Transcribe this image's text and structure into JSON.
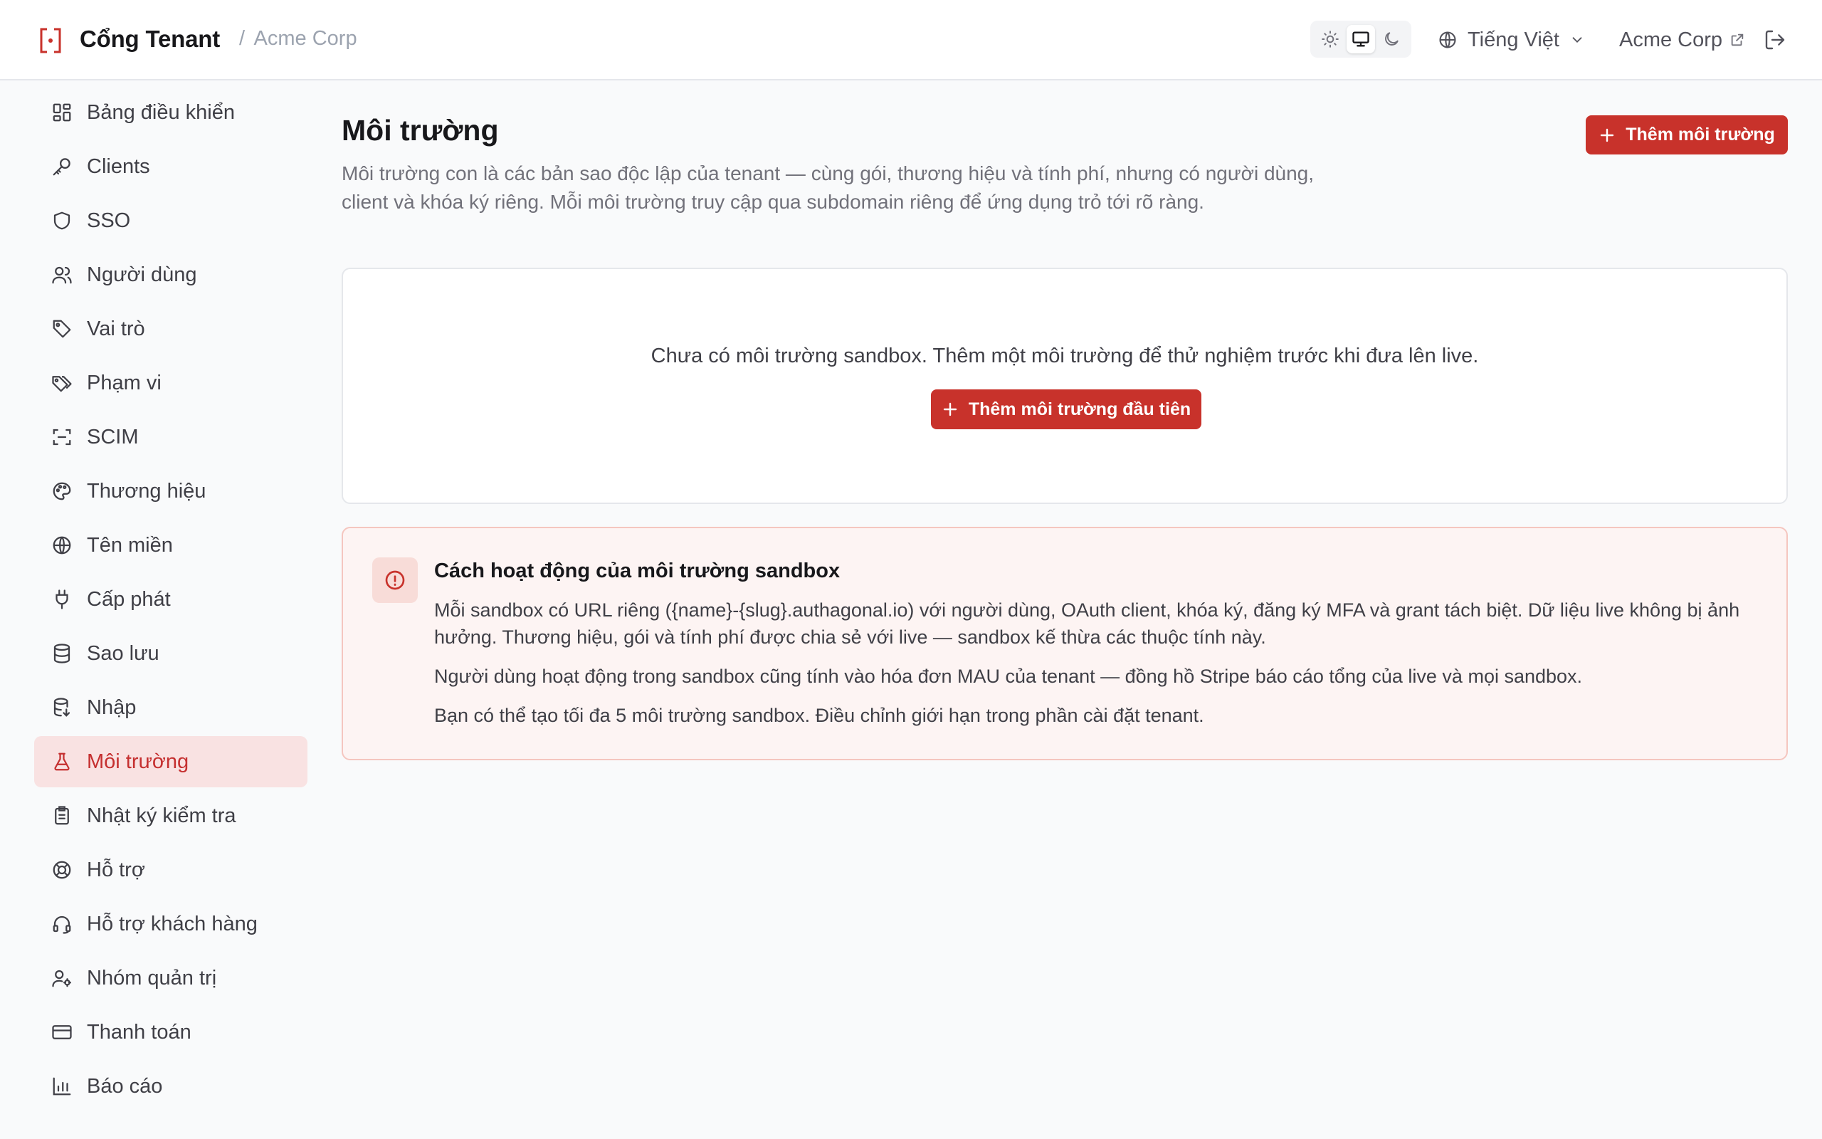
{
  "header": {
    "app_title": "Cổng Tenant",
    "breadcrumb_sep": "/",
    "breadcrumb_tenant": "Acme Corp",
    "theme_options": [
      "light",
      "system",
      "dark"
    ],
    "theme_selected": "system",
    "language": "Tiếng Việt",
    "tenant_link": "Acme Corp"
  },
  "sidebar": {
    "items": [
      {
        "label": "Bảng điều khiển",
        "icon": "dashboard-icon"
      },
      {
        "label": "Clients",
        "icon": "key-icon"
      },
      {
        "label": "SSO",
        "icon": "shield-icon"
      },
      {
        "label": "Người dùng",
        "icon": "users-icon"
      },
      {
        "label": "Vai trò",
        "icon": "tag-icon"
      },
      {
        "label": "Phạm vi",
        "icon": "tags-icon"
      },
      {
        "label": "SCIM",
        "icon": "scan-icon"
      },
      {
        "label": "Thương hiệu",
        "icon": "palette-icon"
      },
      {
        "label": "Tên miền",
        "icon": "globe-icon"
      },
      {
        "label": "Cấp phát",
        "icon": "plug-icon"
      },
      {
        "label": "Sao lưu",
        "icon": "database-icon"
      },
      {
        "label": "Nhập",
        "icon": "database-import-icon"
      },
      {
        "label": "Môi trường",
        "icon": "flask-icon"
      },
      {
        "label": "Nhật ký kiểm tra",
        "icon": "clipboard-icon"
      },
      {
        "label": "Hỗ trợ",
        "icon": "lifebuoy-icon"
      },
      {
        "label": "Hỗ trợ khách hàng",
        "icon": "headset-icon"
      },
      {
        "label": "Nhóm quản trị",
        "icon": "user-cog-icon"
      },
      {
        "label": "Thanh toán",
        "icon": "credit-card-icon"
      },
      {
        "label": "Báo cáo",
        "icon": "bar-chart-icon"
      }
    ],
    "active_index": 12
  },
  "main": {
    "title": "Môi trường",
    "description": "Môi trường con là các bản sao độc lập của tenant — cùng gói, thương hiệu và tính phí, nhưng có người dùng, client và khóa ký riêng. Mỗi môi trường truy cập qua subdomain riêng để ứng dụng trỏ tới rõ ràng.",
    "add_button": "Thêm môi trường",
    "empty_text": "Chưa có môi trường sandbox. Thêm một môi trường để thử nghiệm trước khi đưa lên live.",
    "add_first_button": "Thêm môi trường đầu tiên",
    "info": {
      "title": "Cách hoạt động của môi trường sandbox",
      "paragraphs": [
        "Mỗi sandbox có URL riêng ({name}-{slug}.authagonal.io) với người dùng, OAuth client, khóa ký, đăng ký MFA và grant tách biệt. Dữ liệu live không bị ảnh hưởng. Thương hiệu, gói và tính phí được chia sẻ với live — sandbox kế thừa các thuộc tính này.",
        "Người dùng hoạt động trong sandbox cũng tính vào hóa đơn MAU của tenant — đồng hồ Stripe báo cáo tổng của live và mọi sandbox.",
        "Bạn có thể tạo tối đa 5 môi trường sandbox. Điều chỉnh giới hạn trong phần cài đặt tenant."
      ]
    }
  },
  "colors": {
    "accent": "#c8322b",
    "active_nav_bg": "#f9e2e2",
    "info_bg": "#fdf4f3"
  }
}
